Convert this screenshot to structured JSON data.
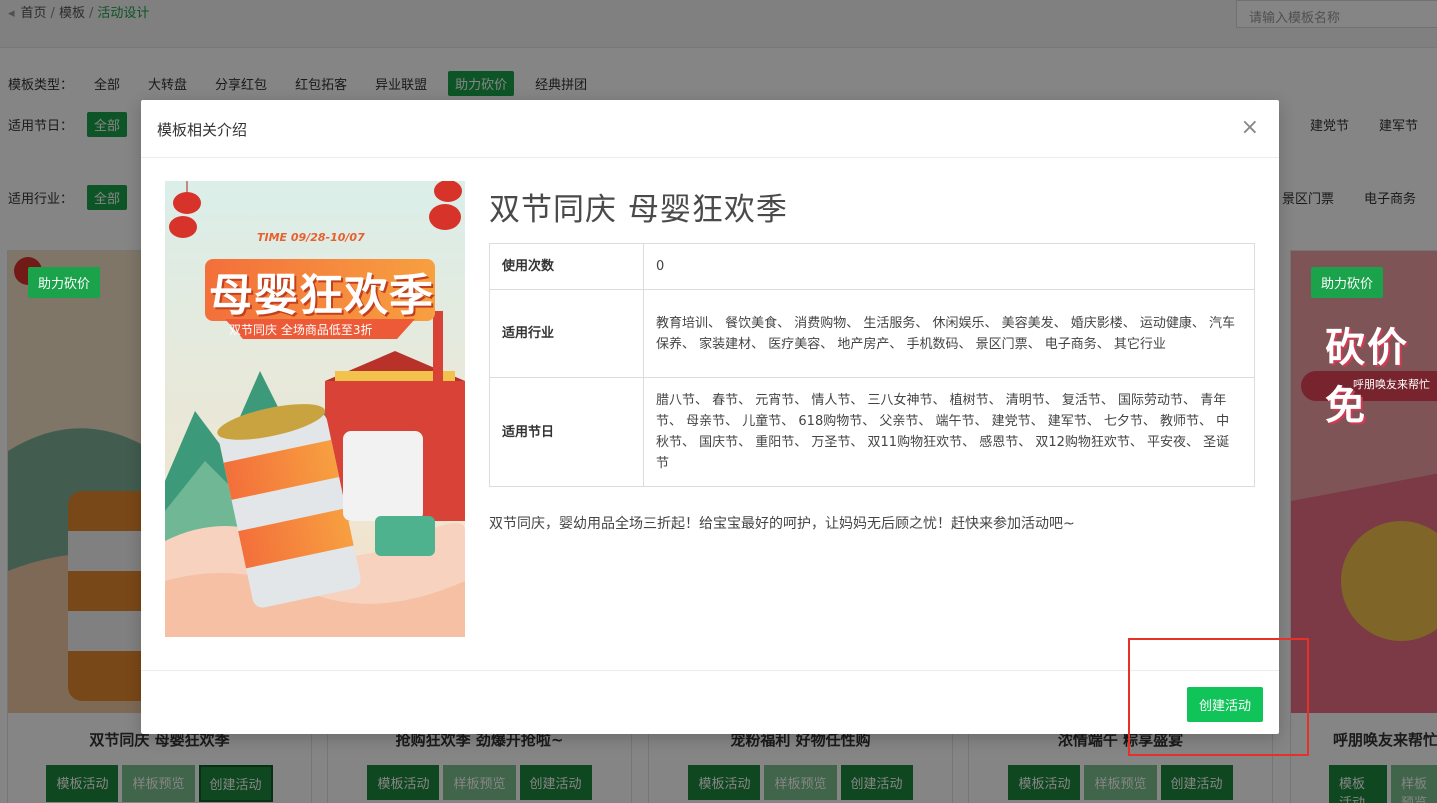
{
  "breadcrumb": {
    "home": "首页",
    "templates": "模板",
    "current": "活动设计",
    "separator": "/"
  },
  "search": {
    "placeholder": "请输入模板名称"
  },
  "filters": {
    "type_label": "模板类型：",
    "type_chips": [
      "全部",
      "大转盘",
      "分享红包",
      "红包拓客",
      "异业联盟",
      "助力砍价",
      "经典拼团"
    ],
    "type_active_index": 5,
    "holiday_label": "适用节日：",
    "holiday_all": "全部",
    "holiday_right": [
      "建党节",
      "建军节"
    ],
    "industry_label": "适用行业：",
    "industry_all": "全部",
    "industry_right": [
      "景区门票",
      "电子商务"
    ]
  },
  "cards": [
    {
      "badge": "助力砍价",
      "title": "双节同庆 母婴狂欢季"
    },
    {
      "badge": "",
      "title": "抢购狂欢季 劲爆开抢啦~"
    },
    {
      "badge": "",
      "title": "宠粉福利 好物任性购"
    },
    {
      "badge": "",
      "title": "浓情端午 粽享盛宴"
    },
    {
      "badge": "助力砍价",
      "title": "呼朋唤友来帮忙"
    }
  ],
  "card_buttons": {
    "template": "模板活动",
    "preview": "样板预览",
    "create": "创建活动"
  },
  "modal": {
    "title": "模板相关介绍",
    "close_icon": "×",
    "detail_title": "双节同庆 母婴狂欢季",
    "rows": [
      {
        "label": "使用次数",
        "value": "0"
      },
      {
        "label": "适用行业",
        "value": "教育培训、 餐饮美食、 消费购物、 生活服务、 休闲娱乐、 美容美发、 婚庆影楼、 运动健康、 汽车保养、 家装建材、 医疗美容、 地产房产、 手机数码、 景区门票、 电子商务、 其它行业"
      },
      {
        "label": "适用节日",
        "value": "腊八节、 春节、 元宵节、 情人节、 三八女神节、 植树节、 清明节、 复活节、 国际劳动节、 青年节、 母亲节、 儿童节、 618购物节、 父亲节、 端午节、 建党节、 建军节、 七夕节、 教师节、 中秋节、 国庆节、 重阳节、 万圣节、 双11购物狂欢节、 感恩节、 双12购物狂欢节、 平安夜、 圣诞节"
      }
    ],
    "description": "双节同庆，婴幼用品全场三折起！给宝宝最好的呵护，让妈妈无后顾之忧！赶快来参加活动吧~",
    "create_button": "创建活动"
  },
  "poster": {
    "time": "TIME 09/28-10/07",
    "headline": "母婴狂欢季",
    "subline": "双节同庆 全场商品低至3折"
  },
  "card5_poster": {
    "headline": "砍价免",
    "subline": "呼朋唤友来帮忙"
  },
  "colors": {
    "accent": "#1aa34a",
    "create": "#11c45a",
    "highlight": "#e8302a"
  }
}
